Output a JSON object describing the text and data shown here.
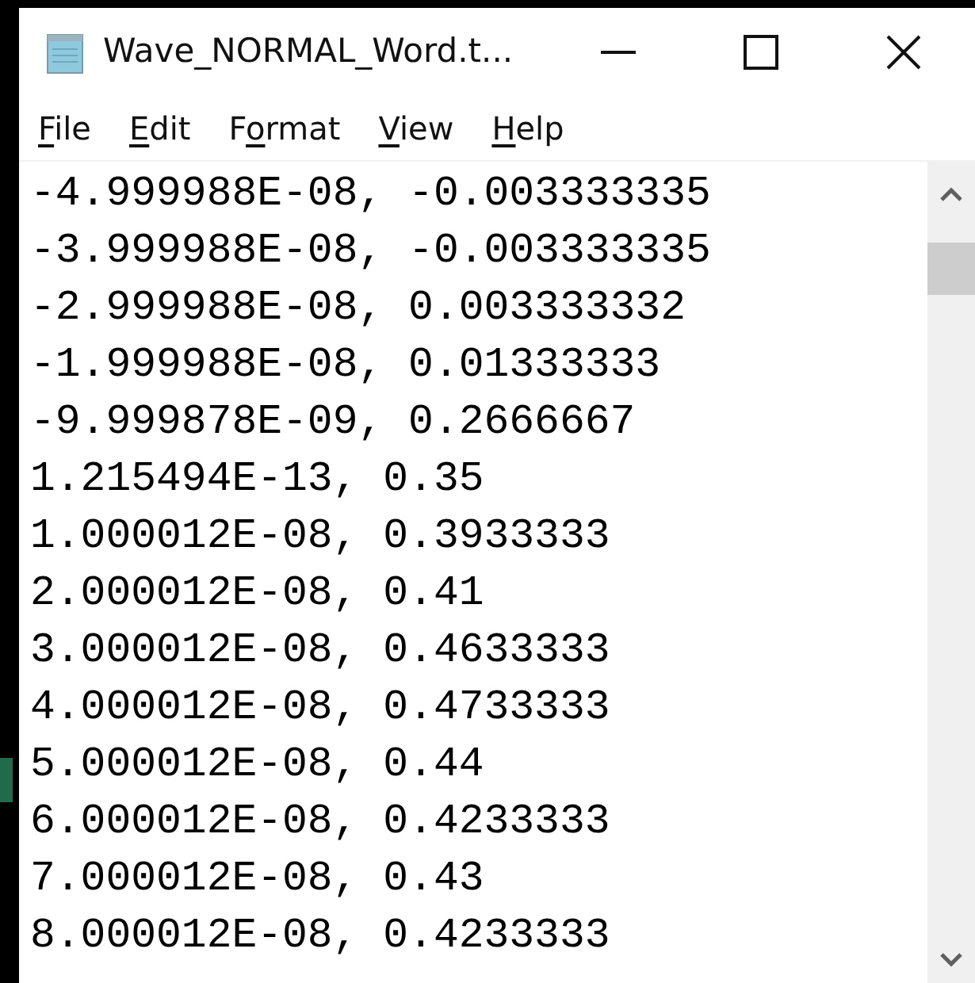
{
  "window": {
    "title": "Wave_NORMAL_Word.t..."
  },
  "menu": [
    {
      "mnemonic": "F",
      "after": "ile"
    },
    {
      "mnemonic": "E",
      "after": "dit"
    },
    {
      "before": "F",
      "mnemonic": "o",
      "after": "rmat"
    },
    {
      "mnemonic": "V",
      "after": "iew"
    },
    {
      "mnemonic": "H",
      "after": "elp"
    }
  ],
  "lines": [
    "-4.999988E-08, -0.003333335",
    "-3.999988E-08, -0.003333335",
    "-2.999988E-08, 0.003333332",
    "-1.999988E-08, 0.01333333",
    "-9.999878E-09, 0.2666667",
    "1.215494E-13, 0.35",
    "1.000012E-08, 0.3933333",
    "2.000012E-08, 0.41",
    "3.000012E-08, 0.4633333",
    "4.000012E-08, 0.4733333",
    "5.000012E-08, 0.44",
    "6.000012E-08, 0.4233333",
    "7.000012E-08, 0.43",
    "8.000012E-08, 0.4233333"
  ]
}
